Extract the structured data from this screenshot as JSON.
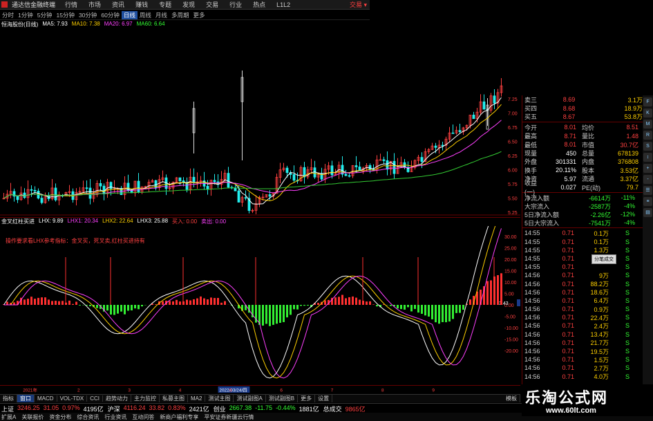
{
  "menubar": {
    "title": "通达信金融终端",
    "items": [
      "行情",
      "市场",
      "资讯",
      "赚钱",
      "专题",
      "发现",
      "交易",
      "行业",
      "热点",
      "L1L2"
    ],
    "right": "交易 ▾"
  },
  "periodbar": {
    "items": [
      "分时",
      "1分钟",
      "5分钟",
      "15分钟",
      "30分钟",
      "60分钟",
      "日线",
      "周线",
      "月线",
      "多周期",
      "更多"
    ],
    "active": "日线"
  },
  "ma_line": {
    "stock": "恒海股份(日线)",
    "ma5": "MA5: 7.93",
    "ma10": "MA10: 7.38",
    "ma20": "MA20: 6.97",
    "ma60": "MA60: 6.64"
  },
  "main_axis": [
    "7.25",
    "7.00",
    "6.75",
    "6.50",
    "6.25",
    "6.00",
    "5.75",
    "5.50",
    "5.25",
    "5.00"
  ],
  "indicator_legend": {
    "name": "金叉红柱买进",
    "lhx": "LHX: 9.89",
    "lhx1": "LHX1: 20.34",
    "lhx2": "LHX2: 22.64",
    "lhx3": "LHX3: 25.88",
    "buy": "买入: 0.00",
    "sell": "卖出: 0.00"
  },
  "indicator_note": "操作要求看LHX参考指标：金叉买，死叉卖,红柱买进持有",
  "indicator_axis": [
    "30.00",
    "25.00",
    "20.00",
    "15.00",
    "10.00",
    "5.00",
    "0.00",
    "-5.00",
    "-10.00",
    "-15.00",
    "-20.00"
  ],
  "indicator_current_label": "3.43",
  "datebar": {
    "left": "2021年",
    "selected": "2022/03/24/四",
    "marks": [
      "2",
      "3",
      "4",
      "5",
      "6",
      "7",
      "8",
      "9"
    ]
  },
  "tabs": [
    "指标",
    "窗口",
    "MACD",
    "VOL-TDX",
    "CCI",
    "趋势动力",
    "主力监控",
    "私募主图",
    "MA2",
    "测试主图",
    "测试副图A",
    "测试副图B",
    "更多",
    "设置"
  ],
  "tabs_right": "模板",
  "statusrow": [
    {
      "label": "上证",
      "value": "3246.25",
      "chg": "31.05",
      "pct": "0.97%",
      "amt": "4195亿"
    },
    {
      "label": "沪深",
      "value": "4116.24",
      "chg": "33.82",
      "pct": "0.83%",
      "amt": "2421亿"
    },
    {
      "label": "创业",
      "value": "2667.38",
      "chg": "-11.75",
      "pct": "-0.44%",
      "amt": "1881亿"
    },
    {
      "label": "总成交",
      "value": "9865亿",
      "chg": "",
      "pct": "",
      "amt": ""
    }
  ],
  "toolrow": [
    "扩展A",
    "关联报价",
    "资金分布",
    "综合资讯",
    "行业资讯",
    "互动问答",
    "新商户福利专享"
  ],
  "toolrow_right": "平安证券新疆云行情",
  "quote": [
    {
      "l": "卖三",
      "v": "8.69",
      "v2": "3.1万"
    },
    {
      "l": "买四",
      "v": "8.68",
      "v2": "18.9万"
    },
    {
      "l": "买五",
      "v": "8.67",
      "v2": "53.8万"
    }
  ],
  "quote2": [
    {
      "l": "今开",
      "v": "8.01",
      "l2": "均价",
      "v2": "8.51"
    },
    {
      "l": "最高",
      "v": "8.71",
      "l2": "量比",
      "v2": "1.48"
    },
    {
      "l": "最低",
      "v": "8.01",
      "l2": "市值",
      "v2": "30.7亿"
    },
    {
      "l": "现量",
      "v": "450",
      "l2": "总量",
      "v2": "678139"
    },
    {
      "l": "外盘",
      "v": "301331",
      "l2": "内盘",
      "v2": "376808"
    },
    {
      "l": "换手",
      "v": "20.11%",
      "l2": "股本",
      "v2": "3.53亿"
    },
    {
      "l": "净资",
      "v": "5.97",
      "l2": "流通",
      "v2": "3.37亿"
    },
    {
      "l": "收益(一)",
      "v": "0.027",
      "l2": "PE(动)",
      "v2": "79.7"
    }
  ],
  "flows": [
    {
      "l": "净流入额",
      "v": "-6614万",
      "p": "-11%"
    },
    {
      "l": "大宗流入",
      "v": "-2587万",
      "p": "-4%"
    },
    {
      "l": "5日净流入额",
      "v": "-2.26亿",
      "p": "-12%"
    },
    {
      "l": "5日大宗流入",
      "v": "-7541万",
      "p": "-4%"
    }
  ],
  "ticks": [
    {
      "t": "14:55",
      "p": "0.71",
      "v": "0.1万",
      "s": "S"
    },
    {
      "t": "14:55",
      "p": "0.71",
      "v": "0.1万",
      "s": "S"
    },
    {
      "t": "14:55",
      "p": "0.71",
      "v": "1.3万",
      "s": "S"
    },
    {
      "t": "14:55",
      "p": "0.71",
      "v": "",
      "s": "S"
    },
    {
      "t": "14:55",
      "p": "0.71",
      "v": "",
      "s": "S"
    },
    {
      "t": "14:56",
      "p": "0.71",
      "v": "9万",
      "s": "S"
    },
    {
      "t": "14:56",
      "p": "0.71",
      "v": "88.2万",
      "s": "S"
    },
    {
      "t": "14:56",
      "p": "0.71",
      "v": "18.6万",
      "s": "S"
    },
    {
      "t": "14:56",
      "p": "0.71",
      "v": "6.4万",
      "s": "S"
    },
    {
      "t": "14:56",
      "p": "0.71",
      "v": "0.9万",
      "s": "S"
    },
    {
      "t": "14:56",
      "p": "0.71",
      "v": "22.4万",
      "s": "S"
    },
    {
      "t": "14:56",
      "p": "0.71",
      "v": "2.4万",
      "s": "S"
    },
    {
      "t": "14:56",
      "p": "0.71",
      "v": "13.4万",
      "s": "S"
    },
    {
      "t": "14:56",
      "p": "0.71",
      "v": "21.7万",
      "s": "S"
    },
    {
      "t": "14:56",
      "p": "0.71",
      "v": "19.5万",
      "s": "S"
    },
    {
      "t": "14:56",
      "p": "0.71",
      "v": "1.5万",
      "s": "S"
    },
    {
      "t": "14:56",
      "p": "0.71",
      "v": "2.7万",
      "s": "S"
    },
    {
      "t": "14:56",
      "p": "0.71",
      "v": "4.0万",
      "s": "S"
    }
  ],
  "ticks_popup": "分笔成交",
  "side_tabs": [
    "F",
    "K",
    "M",
    "R",
    "S",
    "↕",
    "+",
    "-",
    "☰",
    "≡",
    "▤"
  ],
  "watermark": {
    "title": "乐淘公式网",
    "url": "www.60lt.com"
  },
  "colors": {
    "up": "#ff4040",
    "down": "#33ff33",
    "ma5": "#ffffff",
    "ma10": "#ffd000",
    "ma20": "#ff40ff",
    "ma60": "#33cc33"
  }
}
